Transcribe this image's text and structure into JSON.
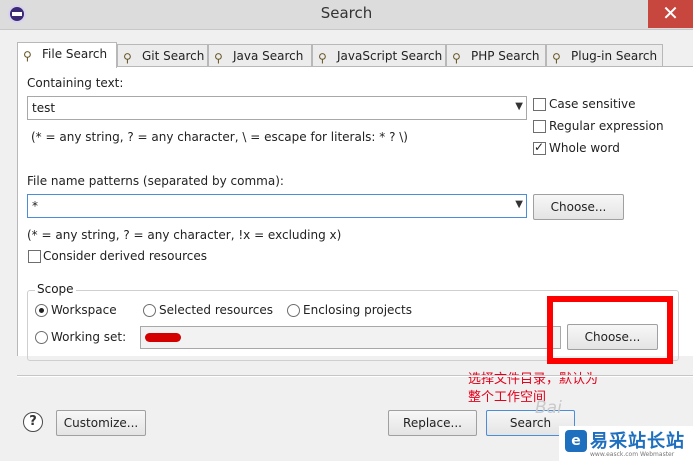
{
  "window": {
    "title": "Search",
    "close_label": "✕"
  },
  "tabs": [
    {
      "label": "File Search",
      "icon": "file-search-icon",
      "active": true
    },
    {
      "label": "Git Search",
      "icon": "git-search-icon"
    },
    {
      "label": "Java Search",
      "icon": "java-search-icon"
    },
    {
      "label": "JavaScript Search",
      "icon": "javascript-search-icon"
    },
    {
      "label": "PHP Search",
      "icon": "php-search-icon"
    },
    {
      "label": "Plug-in Search",
      "icon": "plugin-search-icon"
    }
  ],
  "containing": {
    "label": "Containing text:",
    "value": "test",
    "hint": "(* = any string, ? = any character, \\ = escape for literals: * ? \\)"
  },
  "options": {
    "case_sensitive": {
      "label": "Case sensitive",
      "checked": false
    },
    "regex": {
      "label": "Regular expression",
      "checked": false
    },
    "whole_word": {
      "label": "Whole word",
      "checked": true
    }
  },
  "patterns": {
    "label": "File name patterns (separated by comma):",
    "value": "*",
    "choose": "Choose...",
    "hint": "(* = any string, ? = any character, !x = excluding x)",
    "derived_label": "Consider derived resources"
  },
  "scope": {
    "legend": "Scope",
    "workspace": "Workspace",
    "selected": "Selected resources",
    "enclosing": "Enclosing projects",
    "working_set": "Working set:",
    "choose": "Choose..."
  },
  "annotation": {
    "line1": "选择文件目录，默认为",
    "line2": "整个工作空间"
  },
  "footer": {
    "customize": "Customize...",
    "replace": "Replace...",
    "search": "Search"
  },
  "watermark": {
    "bai": "Bai",
    "site": "易采站长站",
    "url": "www.easck.com  Webmaster"
  },
  "colors": {
    "annotation_red": "#e3001b",
    "focus_blue": "#4b8dd6",
    "brand_blue": "#1f6fbf"
  }
}
